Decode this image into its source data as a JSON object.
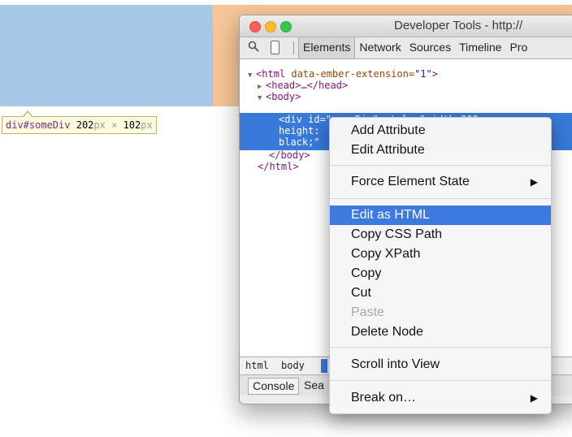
{
  "page": {
    "tooltip": {
      "selector": "div#someDiv",
      "width": "202",
      "height": "102",
      "unit": "px",
      "times": "×"
    }
  },
  "window": {
    "title": "Developer Tools - http://",
    "tabs": [
      "Elements",
      "Network",
      "Sources",
      "Timeline",
      "Pro"
    ],
    "active_tab": "Elements"
  },
  "tree": {
    "line1_tag_open": "<html",
    "line1_attr": " data-ember-extension=",
    "line1_val": "\"1\"",
    "line1_close": ">",
    "line2": "<head>…</head>",
    "line3": "<body>",
    "line4": "<div id=\"someDiv\" style=\"width:200px;",
    "line5": "height:",
    "line6": "black;\"",
    "line7": "</body>",
    "line8": "</html>"
  },
  "breadcrumbs": [
    "html",
    "body"
  ],
  "drawer": {
    "tabs": [
      "Console",
      "Sea"
    ]
  },
  "context_menu": {
    "items": [
      {
        "label": "Add Attribute"
      },
      {
        "label": "Edit Attribute"
      },
      {
        "label": "Force Element State",
        "submenu": "▶"
      },
      {
        "label": "Edit as HTML",
        "highlighted": true
      },
      {
        "label": "Copy CSS Path"
      },
      {
        "label": "Copy XPath"
      },
      {
        "label": "Copy"
      },
      {
        "label": "Cut"
      },
      {
        "label": "Paste",
        "disabled": true
      },
      {
        "label": "Delete Node"
      },
      {
        "label": "Scroll into View"
      },
      {
        "label": "Break on…",
        "submenu": "▶"
      }
    ]
  },
  "colors": {
    "highlight_content": "#a8c8e8",
    "highlight_margin": "#f5c697",
    "selection": "#3879d9",
    "menu_hover": "#3c7ae0"
  }
}
